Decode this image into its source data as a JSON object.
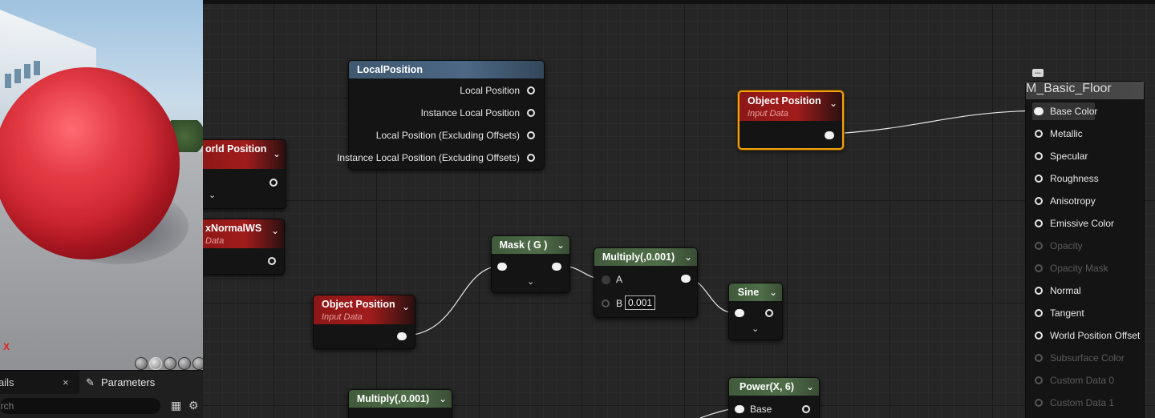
{
  "viewport": {
    "axis_label": "X"
  },
  "panels": {
    "details_tab": {
      "label": "ails",
      "close": "×"
    },
    "parameters_tab": {
      "label": "Parameters",
      "icon": "pencil-icon"
    },
    "search": {
      "placeholder": "arch"
    }
  },
  "graph": {
    "local_position": {
      "title": "LocalPosition",
      "outputs": [
        "Local Position",
        "Instance Local Position",
        "Local Position (Excluding Offsets)",
        "Instance Local Position (Excluding Offsets)"
      ]
    },
    "world_position": {
      "title": "orld Position"
    },
    "vertex_normal": {
      "title": "xNormalWS",
      "subtitle": "Data"
    },
    "object_position_top": {
      "title": "Object Position",
      "subtitle": "Input Data"
    },
    "object_position_bottom": {
      "title": "Object Position",
      "subtitle": "Input Data"
    },
    "mask": {
      "title": "Mask ( G )"
    },
    "multiply_main": {
      "title": "Multiply(,0.001)",
      "pin_a": "A",
      "pin_b": "B",
      "b_value": "0.001"
    },
    "sine": {
      "title": "Sine"
    },
    "multiply_bottom": {
      "title": "Multiply(,0.001)"
    },
    "power": {
      "title": "Power(X, 6)",
      "pin_base": "Base"
    },
    "result": {
      "title": "M_Basic_Floor",
      "inputs": [
        {
          "label": "Base Color",
          "enabled": true
        },
        {
          "label": "Metallic",
          "enabled": true
        },
        {
          "label": "Specular",
          "enabled": true
        },
        {
          "label": "Roughness",
          "enabled": true
        },
        {
          "label": "Anisotropy",
          "enabled": true
        },
        {
          "label": "Emissive Color",
          "enabled": true
        },
        {
          "label": "Opacity",
          "enabled": false
        },
        {
          "label": "Opacity Mask",
          "enabled": false
        },
        {
          "label": "Normal",
          "enabled": true
        },
        {
          "label": "Tangent",
          "enabled": true
        },
        {
          "label": "World Position Offset",
          "enabled": true
        },
        {
          "label": "Subsurface Color",
          "enabled": false
        },
        {
          "label": "Custom Data 0",
          "enabled": false
        },
        {
          "label": "Custom Data 1",
          "enabled": false
        }
      ]
    }
  }
}
